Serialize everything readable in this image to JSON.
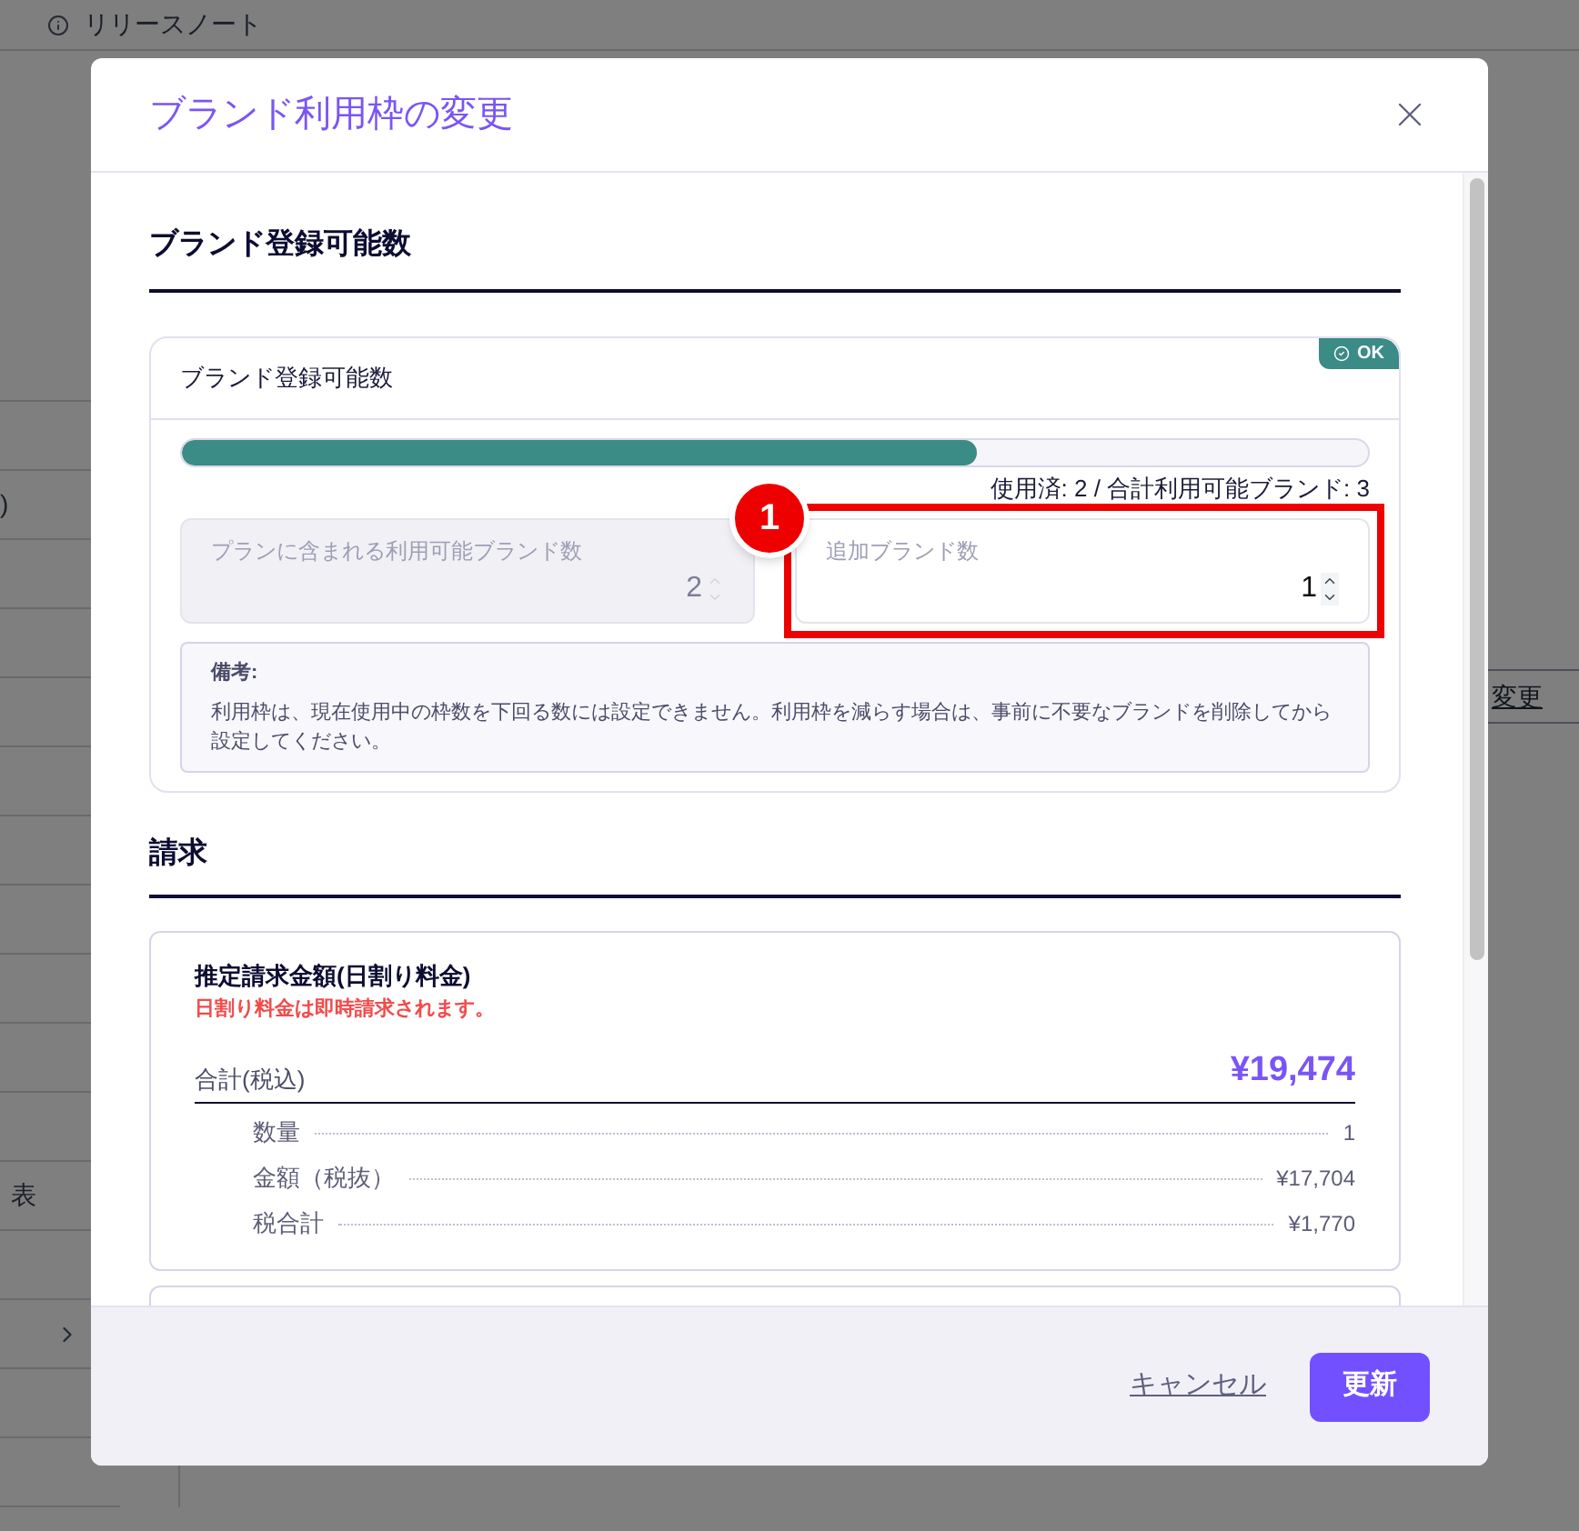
{
  "background": {
    "release_notes": "リリースノート",
    "left_fragments": [
      ")",
      "表"
    ],
    "right_fragment": "変更"
  },
  "dialog": {
    "title": "ブランド利用枠の変更",
    "brand_section": {
      "heading": "ブランド登録可能数",
      "card_title": "ブランド登録可能数",
      "status_badge": "OK",
      "level": 0.67,
      "usage": "使用済: 2 / 合計利用可能ブランド: 3",
      "fields": [
        {
          "label": "プランに含まれる利用可能ブランド数",
          "value": "2",
          "disabled": true,
          "highlighted": false
        },
        {
          "label": "追加ブランド数",
          "value": "1",
          "disabled": false,
          "highlighted": true
        }
      ],
      "annotation": "1",
      "note_title": "備考:",
      "note_text": "利用枠は、現在使用中の枠数を下回る数には設定できません。利用枠を減らす場合は、事前に不要なブランドを削除してから設定してください。"
    },
    "billing_section": {
      "heading": "請求",
      "card_title": "推定請求金額(日割り料金)",
      "warning": "日割り料金は即時請求されます。",
      "total_label": "合計(税込)",
      "total_value": "¥19,474",
      "lines": [
        {
          "label": "数量",
          "value": "1"
        },
        {
          "label": "金額（税抜）",
          "value": "¥17,704"
        },
        {
          "label": "税合計",
          "value": "¥1,770"
        }
      ]
    },
    "cancel": "キャンセル",
    "submit": "更新"
  }
}
